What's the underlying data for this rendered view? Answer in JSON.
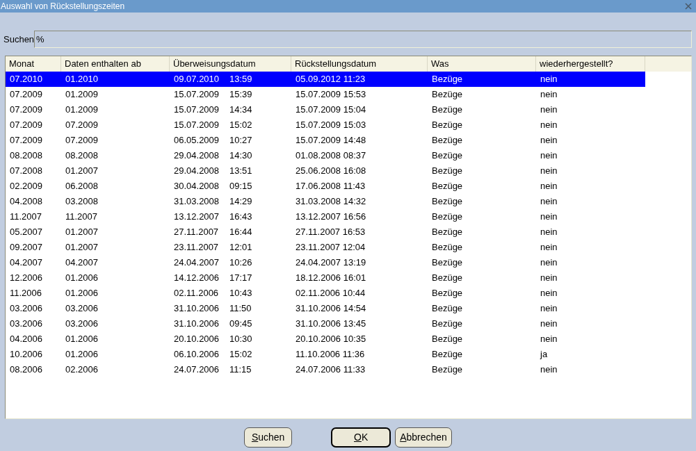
{
  "window": {
    "title": "Auswahl von Rückstellungszeiten"
  },
  "search": {
    "label": "Suchen",
    "value": "%"
  },
  "table": {
    "columns": [
      "Monat",
      "Daten enthalten ab",
      "Überweisungsdatum",
      "Rückstellungsdatum",
      "Was",
      "wiederhergestellt?"
    ],
    "rows": [
      {
        "selected": true,
        "monat": "07.2010",
        "ab": "01.2010",
        "ue_date": "09.07.2010",
        "ue_time": "13:59",
        "rueck": "05.09.2012 11:23",
        "was": "Bezüge",
        "wieder": "nein"
      },
      {
        "selected": false,
        "monat": "07.2009",
        "ab": "01.2009",
        "ue_date": "15.07.2009",
        "ue_time": "15:39",
        "rueck": "15.07.2009 15:53",
        "was": "Bezüge",
        "wieder": "nein"
      },
      {
        "selected": false,
        "monat": "07.2009",
        "ab": "01.2009",
        "ue_date": "15.07.2009",
        "ue_time": "14:34",
        "rueck": "15.07.2009 15:04",
        "was": "Bezüge",
        "wieder": "nein"
      },
      {
        "selected": false,
        "monat": "07.2009",
        "ab": "07.2009",
        "ue_date": "15.07.2009",
        "ue_time": "15:02",
        "rueck": "15.07.2009 15:03",
        "was": "Bezüge",
        "wieder": "nein"
      },
      {
        "selected": false,
        "monat": "07.2009",
        "ab": "07.2009",
        "ue_date": "06.05.2009",
        "ue_time": "10:27",
        "rueck": "15.07.2009 14:48",
        "was": "Bezüge",
        "wieder": "nein"
      },
      {
        "selected": false,
        "monat": "08.2008",
        "ab": "08.2008",
        "ue_date": "29.04.2008",
        "ue_time": "14:30",
        "rueck": "01.08.2008 08:37",
        "was": "Bezüge",
        "wieder": "nein"
      },
      {
        "selected": false,
        "monat": "07.2008",
        "ab": "01.2007",
        "ue_date": "29.04.2008",
        "ue_time": "13:51",
        "rueck": "25.06.2008 16:08",
        "was": "Bezüge",
        "wieder": "nein"
      },
      {
        "selected": false,
        "monat": "02.2009",
        "ab": "06.2008",
        "ue_date": "30.04.2008",
        "ue_time": "09:15",
        "rueck": "17.06.2008 11:43",
        "was": "Bezüge",
        "wieder": "nein"
      },
      {
        "selected": false,
        "monat": "04.2008",
        "ab": "03.2008",
        "ue_date": "31.03.2008",
        "ue_time": "14:29",
        "rueck": "31.03.2008 14:32",
        "was": "Bezüge",
        "wieder": "nein"
      },
      {
        "selected": false,
        "monat": "11.2007",
        "ab": "11.2007",
        "ue_date": "13.12.2007",
        "ue_time": "16:43",
        "rueck": "13.12.2007 16:56",
        "was": "Bezüge",
        "wieder": "nein"
      },
      {
        "selected": false,
        "monat": "05.2007",
        "ab": "01.2007",
        "ue_date": "27.11.2007",
        "ue_time": "16:44",
        "rueck": "27.11.2007 16:53",
        "was": "Bezüge",
        "wieder": "nein"
      },
      {
        "selected": false,
        "monat": "09.2007",
        "ab": "01.2007",
        "ue_date": "23.11.2007",
        "ue_time": "12:01",
        "rueck": "23.11.2007 12:04",
        "was": "Bezüge",
        "wieder": "nein"
      },
      {
        "selected": false,
        "monat": "04.2007",
        "ab": "04.2007",
        "ue_date": "24.04.2007",
        "ue_time": "10:26",
        "rueck": "24.04.2007 13:19",
        "was": "Bezüge",
        "wieder": "nein"
      },
      {
        "selected": false,
        "monat": "12.2006",
        "ab": "01.2006",
        "ue_date": "14.12.2006",
        "ue_time": "17:17",
        "rueck": "18.12.2006 16:01",
        "was": "Bezüge",
        "wieder": "nein"
      },
      {
        "selected": false,
        "monat": "11.2006",
        "ab": "01.2006",
        "ue_date": "02.11.2006",
        "ue_time": "10:43",
        "rueck": "02.11.2006 10:44",
        "was": "Bezüge",
        "wieder": "nein"
      },
      {
        "selected": false,
        "monat": "03.2006",
        "ab": "03.2006",
        "ue_date": "31.10.2006",
        "ue_time": "11:50",
        "rueck": "31.10.2006 14:54",
        "was": "Bezüge",
        "wieder": "nein"
      },
      {
        "selected": false,
        "monat": "03.2006",
        "ab": "03.2006",
        "ue_date": "31.10.2006",
        "ue_time": "09:45",
        "rueck": "31.10.2006 13:45",
        "was": "Bezüge",
        "wieder": "nein"
      },
      {
        "selected": false,
        "monat": "04.2006",
        "ab": "01.2006",
        "ue_date": "20.10.2006",
        "ue_time": "10:30",
        "rueck": "20.10.2006 10:35",
        "was": "Bezüge",
        "wieder": "nein"
      },
      {
        "selected": false,
        "monat": "10.2006",
        "ab": "01.2006",
        "ue_date": "06.10.2006",
        "ue_time": "15:02",
        "rueck": "11.10.2006 11:36",
        "was": "Bezüge",
        "wieder": "ja"
      },
      {
        "selected": false,
        "monat": "08.2006",
        "ab": "02.2006",
        "ue_date": "24.07.2006",
        "ue_time": "11:15",
        "rueck": "24.07.2006 11:33",
        "was": "Bezüge",
        "wieder": "nein"
      }
    ]
  },
  "buttons": [
    {
      "label": "Suchen",
      "default": false,
      "mnemonic_underlined": true
    },
    {
      "label": "OK",
      "default": true,
      "mnemonic_underlined": true
    },
    {
      "label": "Abbrechen",
      "default": false,
      "mnemonic_underlined": true
    }
  ]
}
